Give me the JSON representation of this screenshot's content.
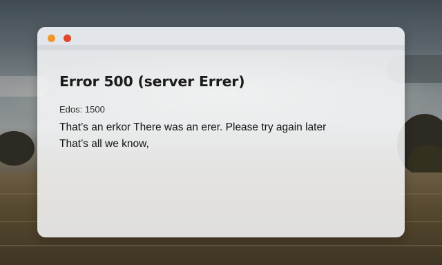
{
  "window": {
    "title": "Error 500 (server Errer)",
    "code_label": "Edos:",
    "code_value": "1500",
    "message_line1": "That’s an erkor There was an erer. Please try again later",
    "message_line2": "That’s all we know,"
  },
  "colors": {
    "close_dot": "#e0472b",
    "minimize_dot": "#f0962b",
    "window_bg": "#f8f9fa"
  }
}
